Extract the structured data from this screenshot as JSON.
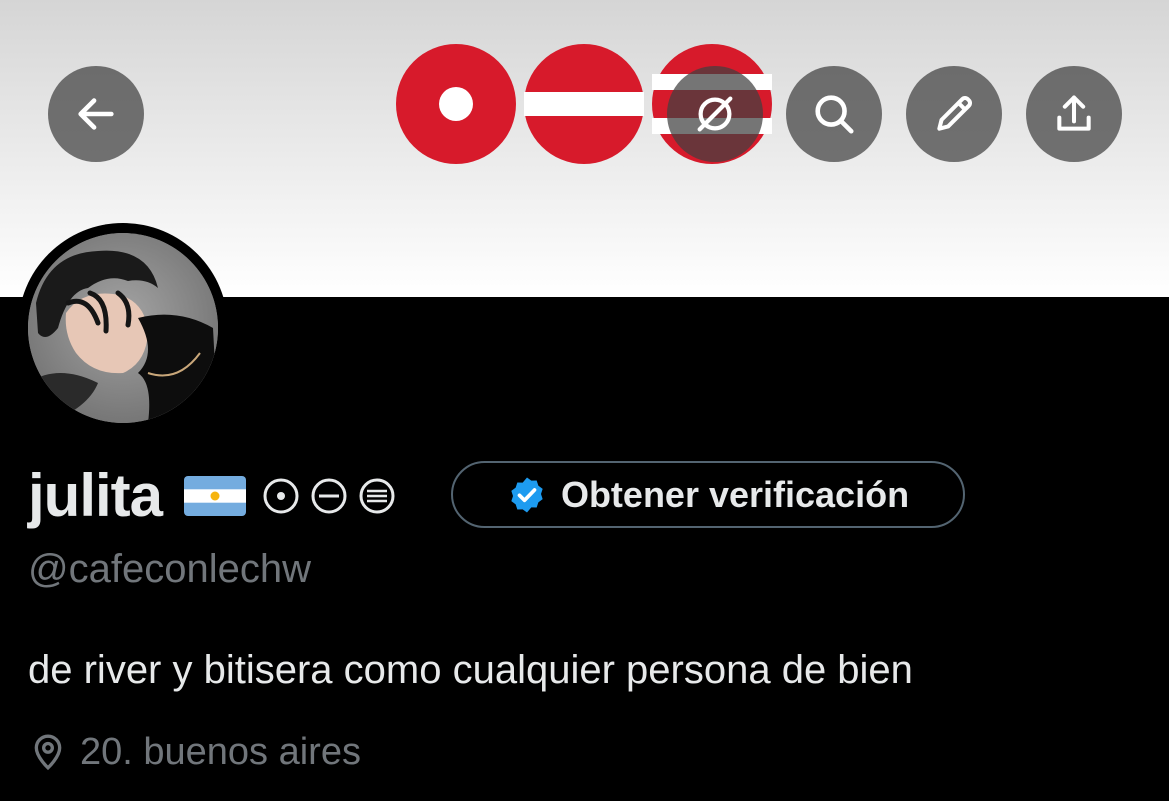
{
  "header": {
    "back_icon": "arrow-left-icon",
    "actions": [
      {
        "name": "grok-icon"
      },
      {
        "name": "search-icon"
      },
      {
        "name": "edit-icon"
      },
      {
        "name": "share-icon"
      }
    ]
  },
  "banner": {
    "description_colors": {
      "background": "#e6e6e6",
      "shapes": "#d71a2b"
    }
  },
  "profile": {
    "display_name": "julita",
    "name_decorations": [
      "argentina-flag-emoji",
      "circled-dot",
      "circled-minus",
      "circled-equals"
    ],
    "verify_button_label": "Obtener verificación",
    "verify_badge_color": "#1d9bf0",
    "handle": "@cafeconlechw",
    "bio": "de river y bitisera como cualquier persona de bien",
    "location_icon": "location-pin-icon",
    "location": "20. buenos aires"
  }
}
